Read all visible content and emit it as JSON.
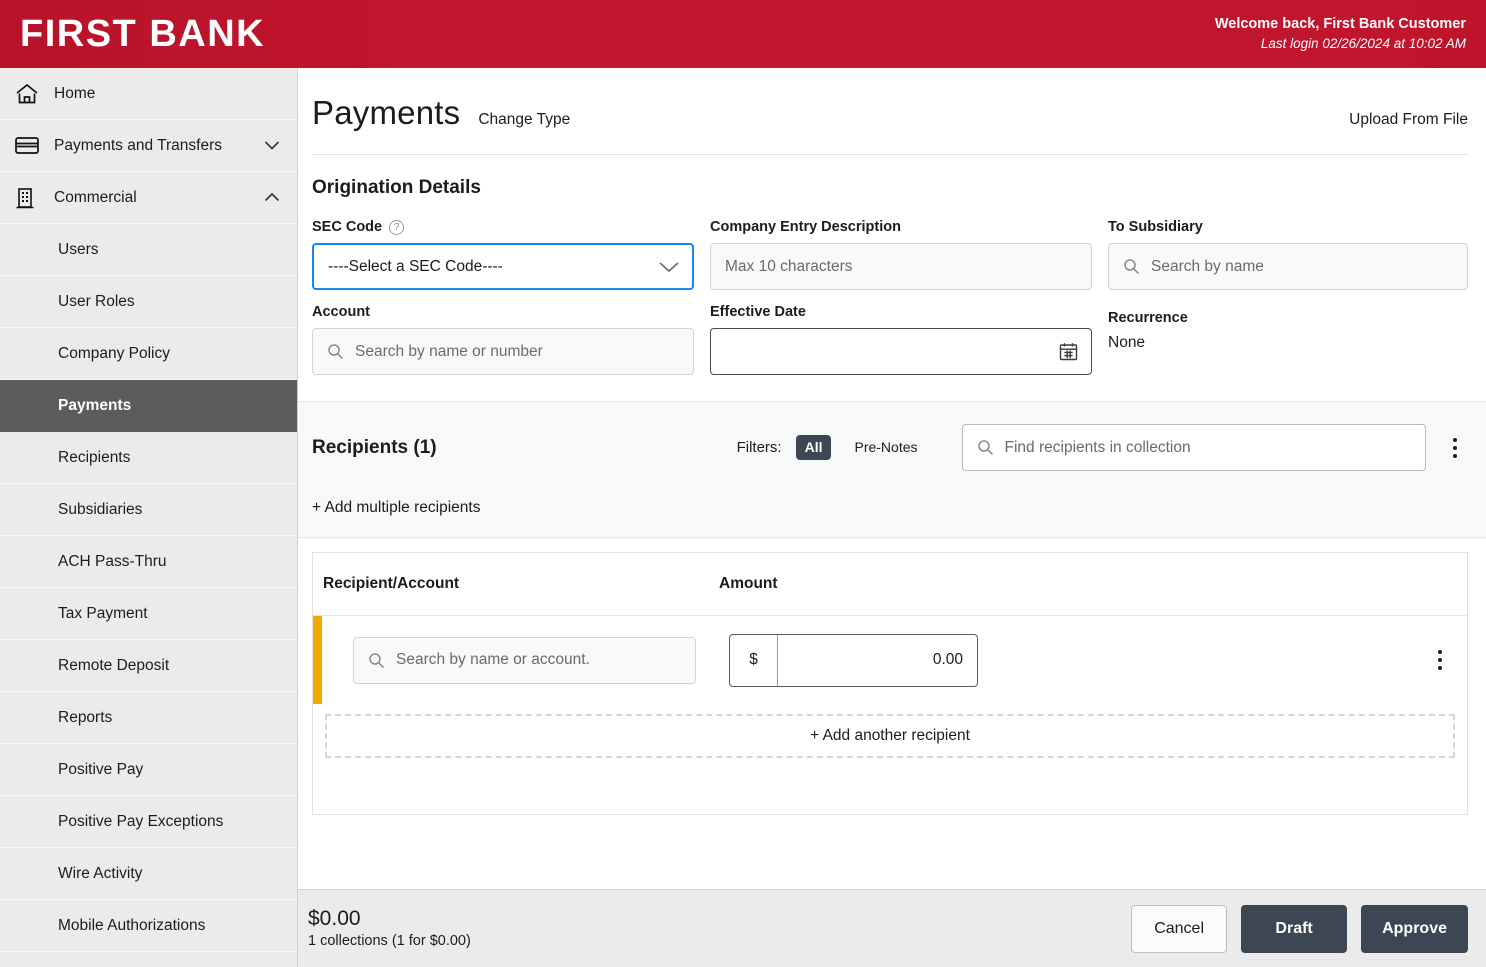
{
  "brand": {
    "logo_text": "FIRST BANK",
    "header_color": "#bf152c"
  },
  "welcome": {
    "greeting": "Welcome back, First Bank Customer",
    "last_login": "Last login 02/26/2024 at 10:02 AM"
  },
  "sidebar": {
    "items": [
      {
        "label": "Home",
        "icon": "home-icon",
        "type": "top",
        "chevron": "",
        "active": false
      },
      {
        "label": "Payments and Transfers",
        "icon": "card-icon",
        "type": "top",
        "chevron": "down",
        "active": false
      },
      {
        "label": "Commercial",
        "icon": "building-icon",
        "type": "top",
        "chevron": "up",
        "active": false
      },
      {
        "label": "Users",
        "type": "sub",
        "active": false
      },
      {
        "label": "User Roles",
        "type": "sub",
        "active": false
      },
      {
        "label": "Company Policy",
        "type": "sub",
        "active": false
      },
      {
        "label": "Payments",
        "type": "sub",
        "active": true
      },
      {
        "label": "Recipients",
        "type": "sub",
        "active": false
      },
      {
        "label": "Subsidiaries",
        "type": "sub",
        "active": false
      },
      {
        "label": "ACH Pass-Thru",
        "type": "sub",
        "active": false
      },
      {
        "label": "Tax Payment",
        "type": "sub",
        "active": false
      },
      {
        "label": "Remote Deposit",
        "type": "sub",
        "active": false
      },
      {
        "label": "Reports",
        "type": "sub",
        "active": false
      },
      {
        "label": "Positive Pay",
        "type": "sub",
        "active": false
      },
      {
        "label": "Positive Pay Exceptions",
        "type": "sub",
        "active": false
      },
      {
        "label": "Wire Activity",
        "type": "sub",
        "active": false
      },
      {
        "label": "Mobile Authorizations",
        "type": "sub",
        "active": false
      }
    ]
  },
  "page": {
    "title": "Payments",
    "change_type": "Change Type",
    "upload_from_file": "Upload From File"
  },
  "origination": {
    "section_title": "Origination Details",
    "sec_code": {
      "label": "SEC Code",
      "help_glyph": "?",
      "value": "----Select a SEC Code----",
      "focused": true
    },
    "company_entry_description": {
      "label": "Company Entry Description",
      "placeholder": "Max 10 characters",
      "value": ""
    },
    "to_subsidiary": {
      "label": "To Subsidiary",
      "placeholder": "Search by name",
      "value": ""
    },
    "account": {
      "label": "Account",
      "placeholder": "Search by name or number",
      "value": ""
    },
    "effective_date": {
      "label": "Effective Date",
      "value": ""
    },
    "recurrence": {
      "label": "Recurrence",
      "value": "None"
    }
  },
  "recipients": {
    "heading": "Recipients (1)",
    "filters_label": "Filters:",
    "filter_all": "All",
    "filter_prenotes": "Pre-Notes",
    "find_placeholder": "Find recipients in collection",
    "add_multiple": "+ Add multiple recipients",
    "columns": {
      "recipient": "Recipient/Account",
      "amount": "Amount"
    },
    "rows": [
      {
        "recipient_placeholder": "Search by name or account.",
        "recipient_value": "",
        "currency_symbol": "$",
        "amount": "0.00",
        "accent_color": "#f2a900"
      }
    ],
    "add_another": "+ Add another recipient"
  },
  "footer": {
    "total": "$0.00",
    "summary": "1 collections (1 for $0.00)",
    "cancel": "Cancel",
    "draft": "Draft",
    "approve": "Approve"
  }
}
